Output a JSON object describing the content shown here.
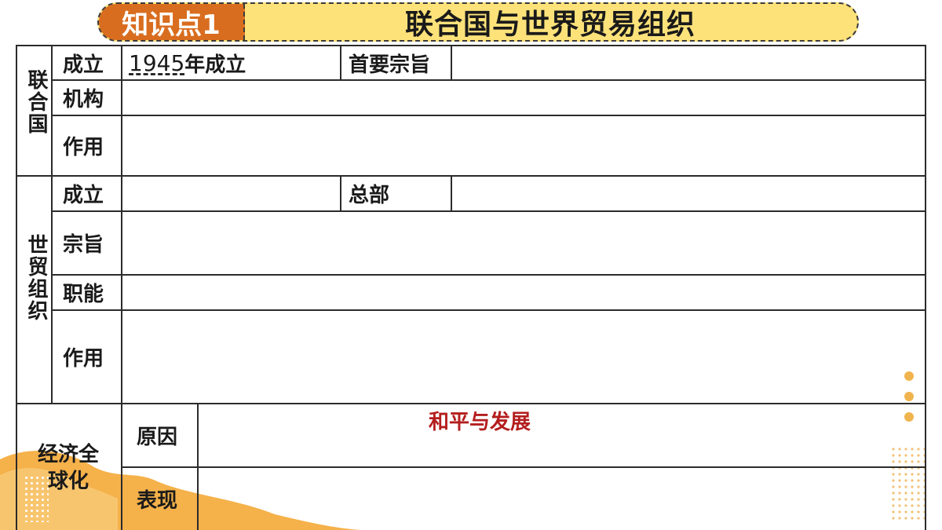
{
  "banner": {
    "badge": "知识点1",
    "title": "联合国与世界贸易组织"
  },
  "un": {
    "label": "联合国",
    "rows": {
      "established_label": "成立",
      "established_year": "1945",
      "established_suffix": "年成立",
      "purpose_label": "首要宗旨",
      "organs_label": "机构",
      "role_label": "作用"
    }
  },
  "wto": {
    "label": "世贸组织",
    "rows": {
      "established_label": "成立",
      "hq_label": "总部",
      "purpose_label": "宗旨",
      "functions_label": "职能",
      "role_label": "作用"
    }
  },
  "globalization": {
    "label": "经济全球化",
    "label_line1": "经济全",
    "label_line2": "球化",
    "reason_label": "原因",
    "reason_answer": "和平与发展",
    "manifest_label": "表现"
  },
  "colors": {
    "badge": "#d96d1f",
    "banner": "#fde27a",
    "answer": "#b41e1e",
    "accent_orange": "#f0a93a"
  }
}
